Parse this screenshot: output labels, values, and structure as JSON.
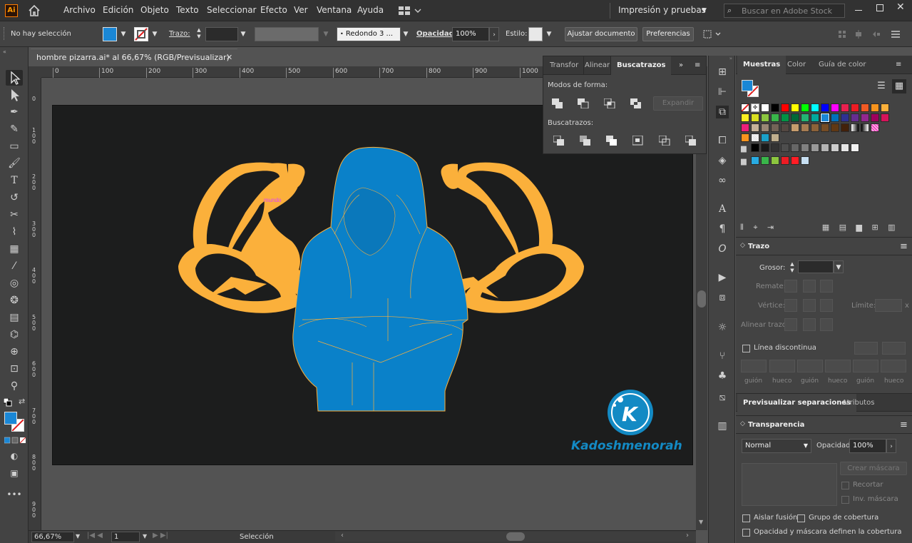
{
  "app": {
    "logo": "Ai"
  },
  "menu": {
    "items": [
      "Archivo",
      "Edición",
      "Objeto",
      "Texto",
      "Seleccionar",
      "Efecto",
      "Ver",
      "Ventana",
      "Ayuda"
    ],
    "workspace": "Impresión y pruebas",
    "search_placeholder": "Buscar en Adobe Stock"
  },
  "control": {
    "selection": "No hay selección",
    "stroke_label": "Trazo:",
    "brush": "Redondo 3 ...",
    "opacity_label": "Opacidad:",
    "opacity_value": "100%",
    "style_label": "Estilo:",
    "adjust_doc": "Ajustar documento",
    "preferences": "Preferencias"
  },
  "colors": {
    "fill": "#1a87d6",
    "artboard_bg": "#1c1d1d",
    "arms": "#fbb03b",
    "figure": "#0a81c9",
    "logo": "#138ac4"
  },
  "document": {
    "tab_title": "hombre pizarra.ai* al 66,67% (RGB/Previsualizar)",
    "ruler_h": [
      "0",
      "100",
      "200",
      "300",
      "400",
      "500",
      "600",
      "700",
      "800",
      "900",
      "1000"
    ],
    "ruler_v": [
      [
        "0"
      ],
      [
        "1",
        "0",
        "0"
      ],
      [
        "2",
        "0",
        "0"
      ],
      [
        "3",
        "0",
        "0"
      ],
      [
        "4",
        "0",
        "0"
      ],
      [
        "5",
        "0",
        "0"
      ],
      [
        "6",
        "0",
        "0"
      ],
      [
        "7",
        "0",
        "0"
      ],
      [
        "8",
        "0",
        "0"
      ],
      [
        "9",
        "0",
        "0"
      ]
    ],
    "brand": "Kadoshmenorah",
    "brand_letter": "K",
    "artwork_label": "mundo"
  },
  "status": {
    "zoom": "66,67%",
    "page": "1",
    "mode": "Selección"
  },
  "pathfinder": {
    "tabs": [
      "Transfor",
      "Alinear",
      "Buscatrazos"
    ],
    "shape_modes": "Modos de forma:",
    "expand": "Expandir",
    "pathfinders": "Buscatrazos:"
  },
  "swatches_panel": {
    "tabs": [
      "Muestras",
      "Color",
      "Guía de color"
    ]
  },
  "stroke_panel": {
    "title": "Trazo",
    "weight": "Grosor:",
    "cap": "Remate:",
    "corner": "Vértice:",
    "limit": "Límite:",
    "limit_x": "x",
    "align": "Alinear trazo:",
    "dashed": "Línea discontinua",
    "dash_labels": [
      "guión",
      "hueco",
      "guión",
      "hueco",
      "guión",
      "hueco"
    ]
  },
  "preview_tabs": [
    "Previsualizar separaciones",
    "Atributos"
  ],
  "transparency": {
    "title": "Transparencia",
    "blend": "Normal",
    "opacity_label": "Opacidad:",
    "opacity": "100%",
    "make_mask": "Crear máscara",
    "clip": "Recortar",
    "invert": "Inv. máscara",
    "isolate": "Aislar fusión",
    "knockout": "Grupo de cobertura",
    "shape_opacity": "Opacidad y máscara definen la cobertura"
  }
}
